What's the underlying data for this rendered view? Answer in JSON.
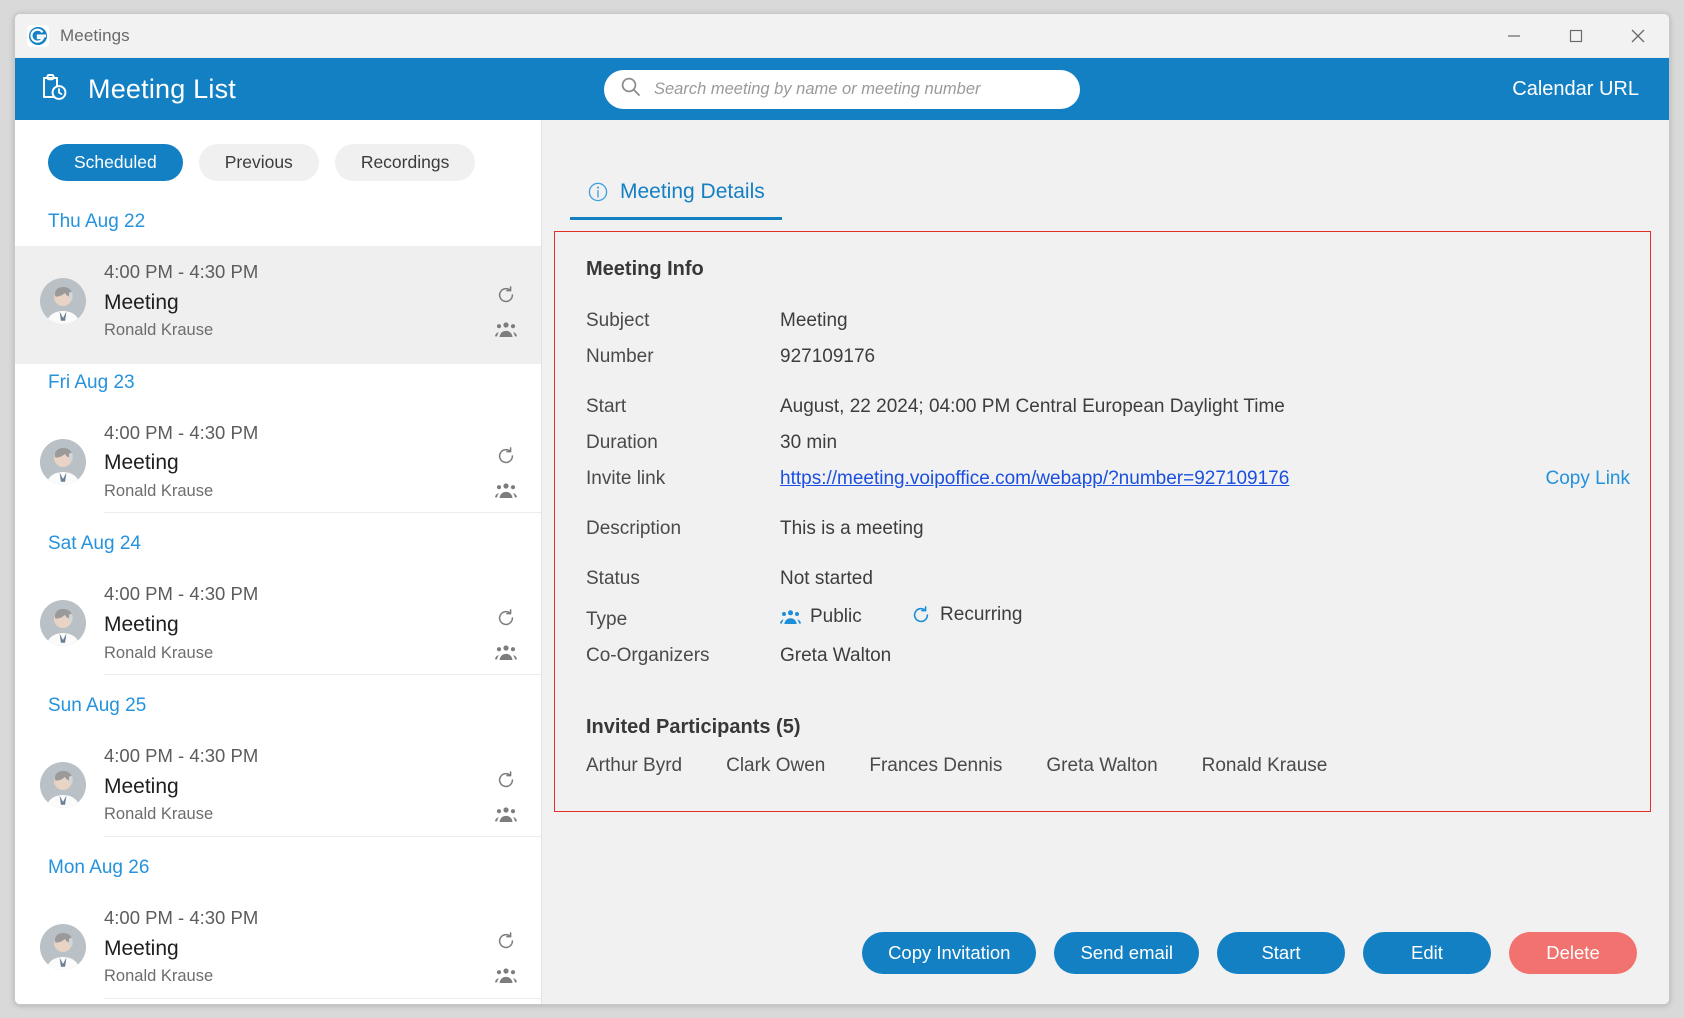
{
  "window": {
    "title": "Meetings",
    "logo_icon": "app-logo-icon",
    "minimize_icon": "minimize-icon",
    "maximize_icon": "maximize-icon",
    "close_icon": "close-icon"
  },
  "header": {
    "title": "Meeting List",
    "title_icon": "clipboard-clock-icon",
    "search": {
      "placeholder": "Search meeting by name or meeting number",
      "value": "",
      "icon": "search-icon"
    },
    "calendar_url_label": "Calendar URL",
    "background_color": "#1380c4"
  },
  "sidebar": {
    "filter_tabs": [
      {
        "label": "Scheduled",
        "active": true
      },
      {
        "label": "Previous",
        "active": false
      },
      {
        "label": "Recordings",
        "active": false
      }
    ],
    "groups": [
      {
        "date": "Thu Aug 22",
        "meetings": [
          {
            "time": "4:00 PM - 4:30 PM",
            "title": "Meeting",
            "host": "Ronald Krause",
            "selected": true,
            "icons": [
              "recurring-icon",
              "participants-icon"
            ]
          }
        ]
      },
      {
        "date": "Fri Aug 23",
        "meetings": [
          {
            "time": "4:00 PM - 4:30 PM",
            "title": "Meeting",
            "host": "Ronald Krause",
            "selected": false,
            "icons": [
              "recurring-icon",
              "participants-icon"
            ]
          }
        ]
      },
      {
        "date": "Sat Aug 24",
        "meetings": [
          {
            "time": "4:00 PM - 4:30 PM",
            "title": "Meeting",
            "host": "Ronald Krause",
            "selected": false,
            "icons": [
              "recurring-icon",
              "participants-icon"
            ]
          }
        ]
      },
      {
        "date": "Sun Aug 25",
        "meetings": [
          {
            "time": "4:00 PM - 4:30 PM",
            "title": "Meeting",
            "host": "Ronald Krause",
            "selected": false,
            "icons": [
              "recurring-icon",
              "participants-icon"
            ]
          }
        ]
      },
      {
        "date": "Mon Aug 26",
        "meetings": [
          {
            "time": "4:00 PM - 4:30 PM",
            "title": "Meeting",
            "host": "Ronald Krause",
            "selected": false,
            "icons": [
              "recurring-icon",
              "participants-icon"
            ]
          }
        ]
      }
    ]
  },
  "detail": {
    "tab_label": "Meeting Details",
    "tab_icon": "info-circle-icon",
    "card_border_color": "#e0302a",
    "info_heading": "Meeting Info",
    "labels": {
      "subject": "Subject",
      "number": "Number",
      "start": "Start",
      "duration": "Duration",
      "invite_link": "Invite link",
      "description": "Description",
      "status": "Status",
      "type": "Type",
      "co_organizers": "Co-Organizers"
    },
    "values": {
      "subject": "Meeting",
      "number": "927109176",
      "start": "August, 22 2024; 04:00 PM Central European Daylight Time",
      "duration": "30 min",
      "invite_link": "https://meeting.voipoffice.com/webapp/?number=927109176",
      "description": "This is a meeting",
      "status": "Not started",
      "type_public": "Public",
      "type_recurring": "Recurring",
      "co_organizers": "Greta Walton"
    },
    "copy_link_label": "Copy Link",
    "participants_heading": "Invited Participants (5)",
    "participants": [
      "Arthur Byrd",
      "Clark Owen",
      "Frances Dennis",
      "Greta Walton",
      "Ronald Krause"
    ],
    "actions": [
      {
        "label": "Copy Invitation",
        "style": "primary"
      },
      {
        "label": "Send email",
        "style": "primary"
      },
      {
        "label": "Start",
        "style": "primary"
      },
      {
        "label": "Edit",
        "style": "primary"
      },
      {
        "label": "Delete",
        "style": "danger"
      }
    ]
  }
}
